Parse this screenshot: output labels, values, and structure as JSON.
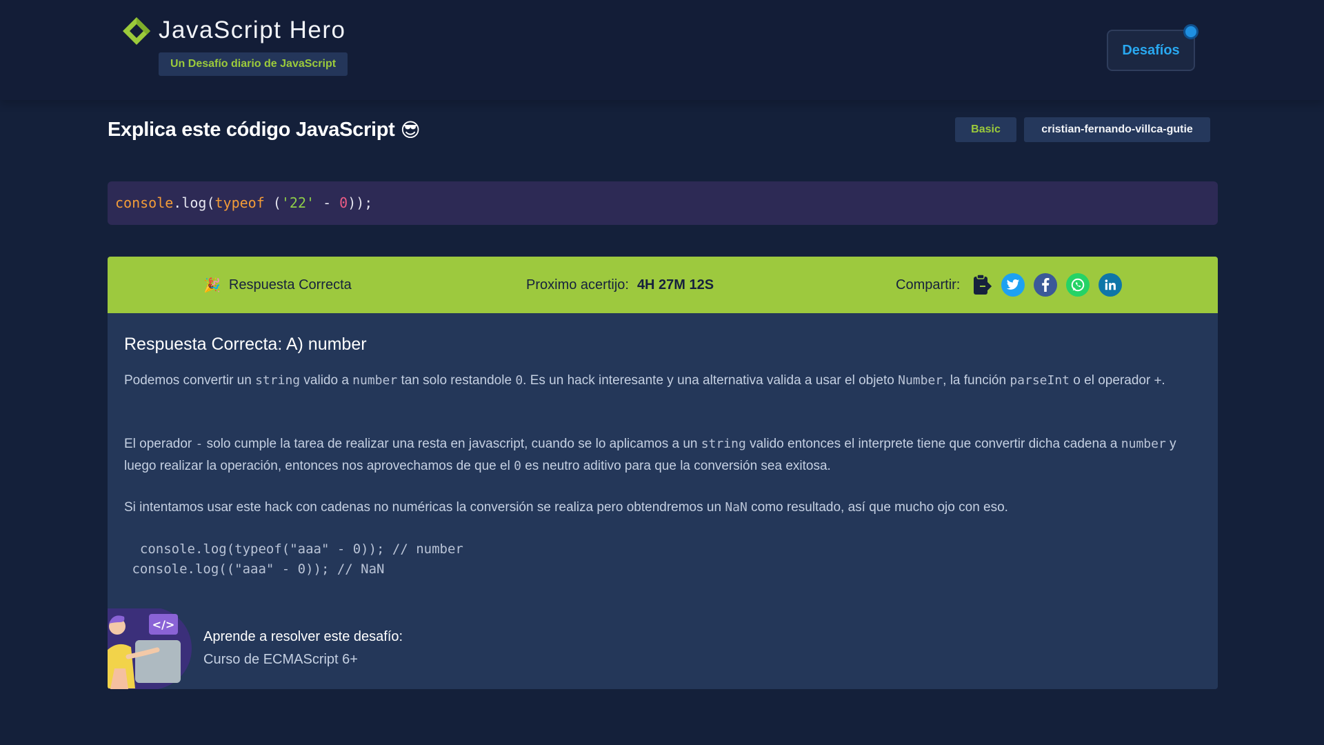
{
  "header": {
    "brand_title": "JavaScript Hero",
    "brand_subtitle": "Un Desafío diario de JavaScript",
    "challenges_button": "Desafíos",
    "accent_color": "#9ccb3b"
  },
  "challenge": {
    "title": "Explica este código JavaScript",
    "title_emoji": "😎",
    "level_tag": "Basic",
    "author_tag": "cristian-fernando-villca-gutie",
    "code": {
      "t1": "console",
      "t2": ".log(",
      "t3": "typeof",
      "t4": " (",
      "t5": "'22'",
      "t6": " - ",
      "t7": "0",
      "t8": "));"
    }
  },
  "result": {
    "status_emoji": "🎉",
    "status_text": "Respuesta Correcta",
    "next_label": "Proximo acertijo:",
    "next_time": "4H 27M 12S",
    "share_label": "Compartir:",
    "share_icons": [
      "clipboard-icon",
      "twitter-icon",
      "facebook-icon",
      "whatsapp-icon",
      "linkedin-icon"
    ],
    "bar_color": "#9dc93e"
  },
  "explanation": {
    "title": "Respuesta Correcta: A) number",
    "p1": {
      "a": "Podemos convertir un ",
      "c1": "string",
      "b": " valido a ",
      "c2": "number",
      "c": " tan solo restandole ",
      "c3": "0",
      "d": ". Es un hack interesante y una alternativa valida a usar el objeto ",
      "c4": "Number",
      "e": ", la función ",
      "c5": "parseInt",
      "f": " o el operador ",
      "c6": "+",
      "g": "."
    },
    "p2": {
      "a": "El operador ",
      "c1": "-",
      "b": " solo cumple la tarea de realizar una resta en javascript, cuando se lo aplicamos a un ",
      "c2": "string",
      "c": " valido entonces el interprete tiene que convertir dicha cadena a ",
      "c3": "number",
      "d": " y luego realizar la operación, entonces nos aprovechamos de que el ",
      "c4": "0",
      "e": " es neutro aditivo para que la conversión sea exitosa."
    },
    "p3": {
      "a": "Si intentamos usar este hack con cadenas no numéricas la conversión se realiza pero obtendremos un ",
      "c1": "NaN",
      "b": " como resultado, así que mucho ojo con eso."
    },
    "example_line1": "  console.log(typeof(\"aaa\" - 0)); // number",
    "example_line2": " console.log((\"aaa\" - 0)); // NaN"
  },
  "course": {
    "label": "Aprende a resolver este desafío:",
    "name": "Curso de ECMAScript 6+"
  }
}
